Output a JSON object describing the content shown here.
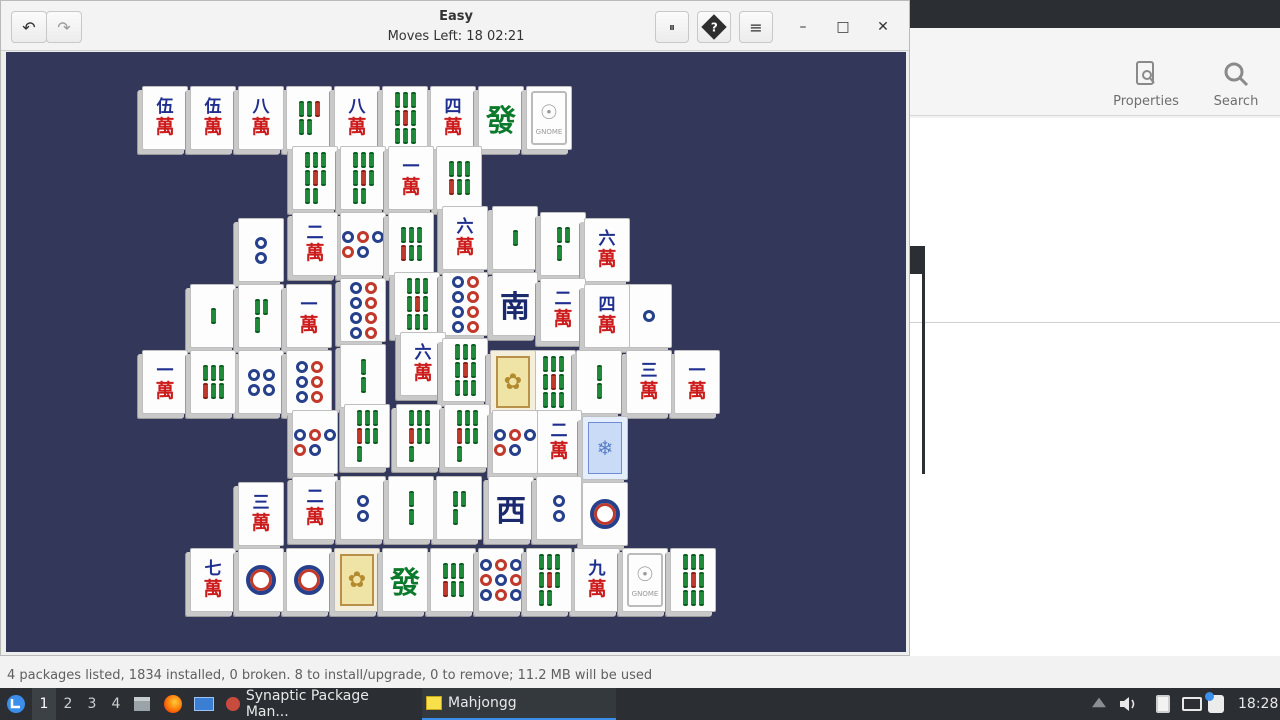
{
  "synaptic": {
    "toolbar": {
      "properties_label": "Properties",
      "search_label": "Search"
    },
    "status_text": "4 packages listed, 1834 installed, 0 broken. 8 to install/upgrade, 0 to remove; 11.2 MB will be used"
  },
  "mahjongg": {
    "title": "Easy",
    "subtitle": "Moves Left: 18   02:21",
    "buttons": {
      "undo": "↶",
      "redo": "↷",
      "pause": "⏸",
      "hint": "?",
      "menu": "≡",
      "minimize": "–",
      "maximize": "□",
      "close": "✕"
    },
    "board_color": "#33375a",
    "tiles": [
      {
        "t": "wan",
        "num": "伍"
      },
      {
        "t": "wan",
        "num": "伍"
      },
      {
        "t": "wan",
        "num": "八"
      },
      {
        "t": "bam",
        "n": 5
      },
      {
        "t": "wan",
        "num": "八"
      },
      {
        "t": "bam",
        "n": 9
      },
      {
        "t": "wan",
        "num": "四"
      },
      {
        "t": "big",
        "char": "發",
        "color": "#0c7a2c"
      },
      {
        "t": "gnome",
        "label": "GNOME"
      },
      {
        "t": "bam",
        "n": 8
      },
      {
        "t": "bam",
        "n": 8
      },
      {
        "t": "wan",
        "num": "一"
      },
      {
        "t": "bam",
        "n": 6
      },
      {
        "t": "dot",
        "n": 2
      },
      {
        "t": "wan",
        "num": "二"
      },
      {
        "t": "dot",
        "n": 5
      },
      {
        "t": "bam",
        "n": 6
      },
      {
        "t": "wan",
        "num": "六"
      },
      {
        "t": "bam",
        "n": 1
      },
      {
        "t": "bam",
        "n": 3
      },
      {
        "t": "wan",
        "num": "六"
      },
      {
        "t": "bam",
        "n": 1
      },
      {
        "t": "bam",
        "n": 3
      },
      {
        "t": "wan",
        "num": "一"
      },
      {
        "t": "dot",
        "n": 8
      },
      {
        "t": "bam",
        "n": 9
      },
      {
        "t": "dot",
        "n": 8
      },
      {
        "t": "big",
        "char": "南",
        "color": "#1a2a6c"
      },
      {
        "t": "wan",
        "num": "二"
      },
      {
        "t": "wan",
        "num": "四"
      },
      {
        "t": "dot",
        "n": 1
      },
      {
        "t": "wan",
        "num": "一"
      },
      {
        "t": "bam",
        "n": 6
      },
      {
        "t": "dot",
        "n": 4
      },
      {
        "t": "dot",
        "n": 6
      },
      {
        "t": "bam",
        "n": 2
      },
      {
        "t": "wan",
        "num": "六"
      },
      {
        "t": "bam",
        "n": 9
      },
      {
        "t": "flower"
      },
      {
        "t": "bam",
        "n": 9
      },
      {
        "t": "bam",
        "n": 2
      },
      {
        "t": "wan",
        "num": "三"
      },
      {
        "t": "wan",
        "num": "一"
      },
      {
        "t": "dot",
        "n": 5
      },
      {
        "t": "bam",
        "n": 7
      },
      {
        "t": "bam",
        "n": 7
      },
      {
        "t": "bam",
        "n": 7
      },
      {
        "t": "dot",
        "n": 5
      },
      {
        "t": "wan",
        "num": "二"
      },
      {
        "t": "season",
        "sel": true
      },
      {
        "t": "wan",
        "num": "三"
      },
      {
        "t": "wan",
        "num": "二"
      },
      {
        "t": "dot",
        "n": 2
      },
      {
        "t": "bam",
        "n": 2
      },
      {
        "t": "bam",
        "n": 3
      },
      {
        "t": "big",
        "char": "西",
        "color": "#1a2a6c"
      },
      {
        "t": "dot",
        "n": 2
      },
      {
        "t": "dotbig"
      },
      {
        "t": "wan",
        "num": "七"
      },
      {
        "t": "dotbig"
      },
      {
        "t": "dotbig"
      },
      {
        "t": "flower"
      },
      {
        "t": "big",
        "char": "發",
        "color": "#0c7a2c"
      },
      {
        "t": "bam",
        "n": 6
      },
      {
        "t": "dot",
        "n": 9
      },
      {
        "t": "bam",
        "n": 8
      },
      {
        "t": "wan",
        "num": "九"
      },
      {
        "t": "gnome",
        "label": "GNOME"
      },
      {
        "t": "bam",
        "n": 9
      }
    ],
    "wan_char": "萬"
  },
  "taskbar": {
    "workspaces": [
      "1",
      "2",
      "3",
      "4"
    ],
    "tasks": [
      {
        "label": "Synaptic Package Man...",
        "icon": "synaptic-icon"
      },
      {
        "label": "Mahjongg",
        "icon": "mahjongg-icon"
      }
    ],
    "clock": "18:28"
  }
}
